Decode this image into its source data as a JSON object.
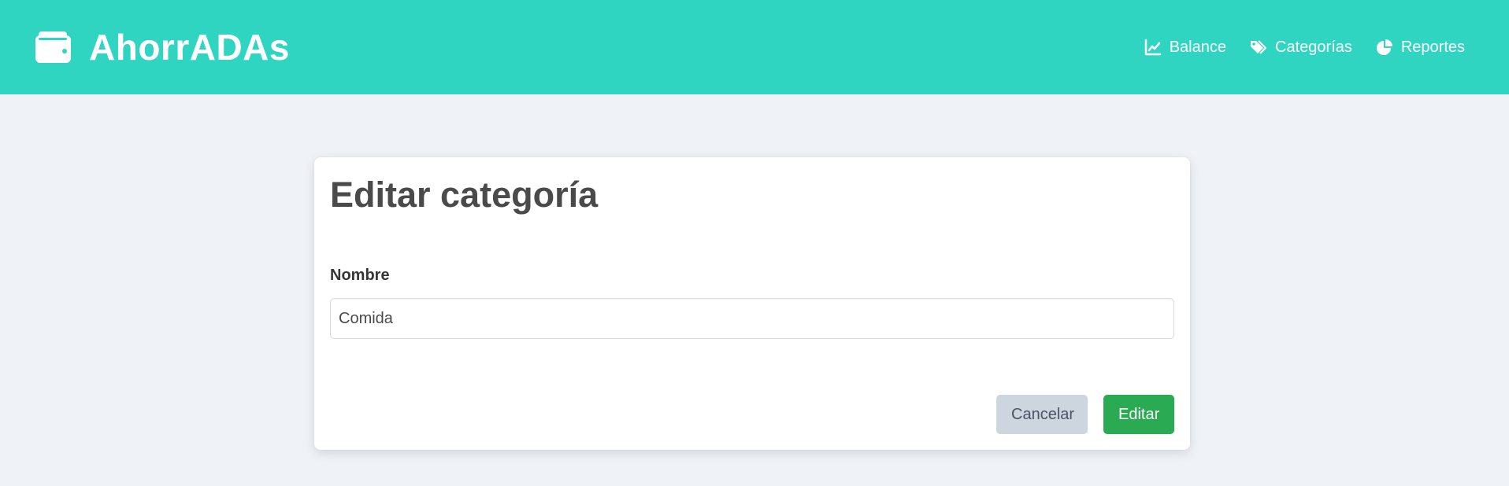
{
  "header": {
    "brand_title": "AhorrADAs",
    "brand_icon": "wallet-icon",
    "background_color": "#2fd5c1",
    "nav": [
      {
        "label": "Balance",
        "icon": "chart-line-icon"
      },
      {
        "label": "Categorías",
        "icon": "tags-icon"
      },
      {
        "label": "Reportes",
        "icon": "pie-chart-icon"
      }
    ]
  },
  "form": {
    "title": "Editar categoría",
    "name_label": "Nombre",
    "name_value": "Comida",
    "cancel_label": "Cancelar",
    "submit_label": "Editar",
    "cancel_color": "#cdd5df",
    "submit_color": "#2aaa52"
  }
}
